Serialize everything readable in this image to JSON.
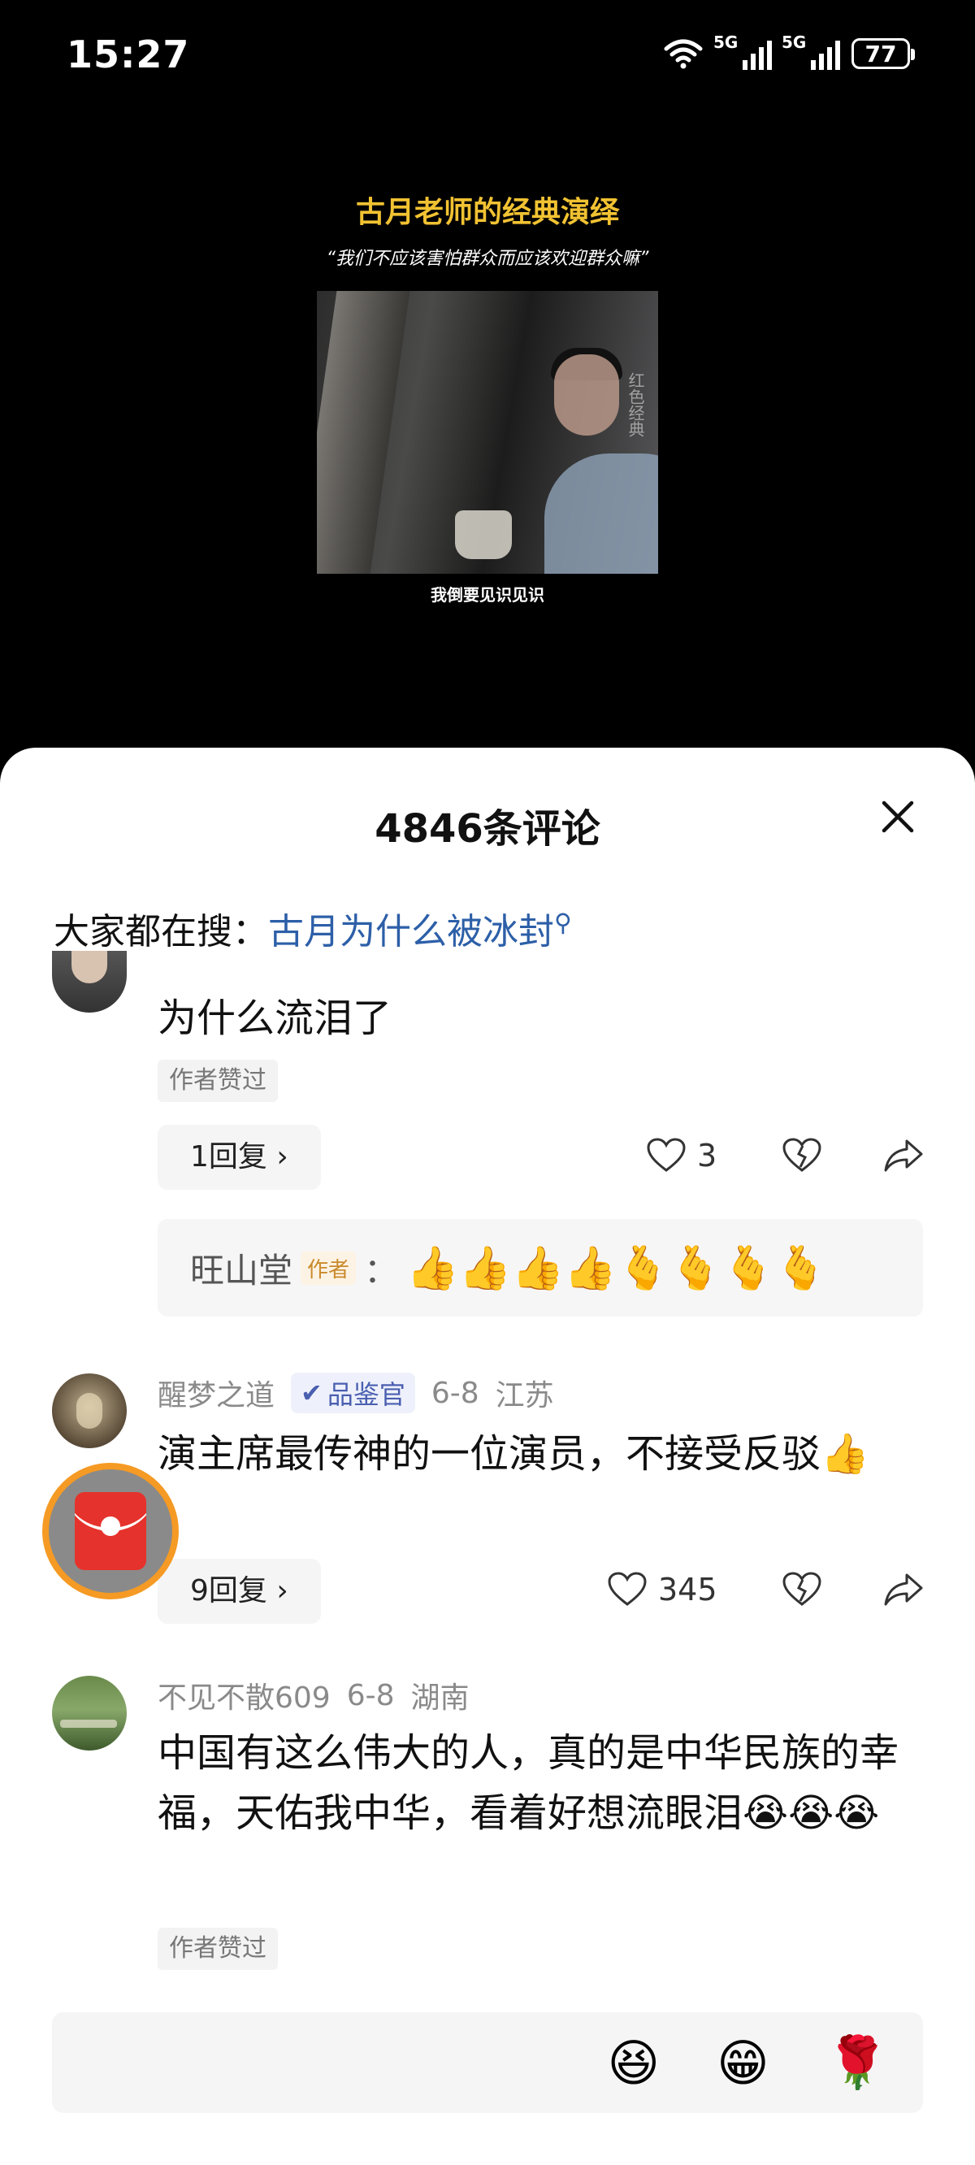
{
  "status": {
    "time": "15:27",
    "battery": "77",
    "network": "5G"
  },
  "video": {
    "title": "古月老师的经典演绎",
    "subtitle": "“我们不应该害怕群众而应该欢迎群众嘛”",
    "watermark": "红色经典",
    "caption": "我倒要见识见识"
  },
  "comments_panel": {
    "title": "4846条评论",
    "search_prefix": "大家都在搜：",
    "search_keyword": "古月为什么被冰封"
  },
  "comment1": {
    "text": "为什么流泪了",
    "badge": "作者赞过",
    "reply_btn": "1回复 ›",
    "likes": "3",
    "reply": {
      "author": "旺山堂",
      "author_tag": "作者",
      "sep": "：",
      "emojis": "👍👍👍👍🫰🫰🫰🫰"
    }
  },
  "comment2": {
    "user": "醒梦之道",
    "role_badge": "品鉴官",
    "date": "6-8",
    "location": "江苏",
    "text": "演主席最传神的一位演员，不接受反驳👍",
    "reply_btn": "9回复 ›",
    "likes": "345"
  },
  "comment3": {
    "user": "不见不散609",
    "date": "6-8",
    "location": "湖南",
    "text": "中国有这么伟大的人，真的是中华民族的幸福，天佑我中华，看着好想流眼泪😭😭😭",
    "badge": "作者赞过"
  },
  "input_bar": {
    "emojis": [
      "😆",
      "😁",
      "🌹"
    ]
  }
}
